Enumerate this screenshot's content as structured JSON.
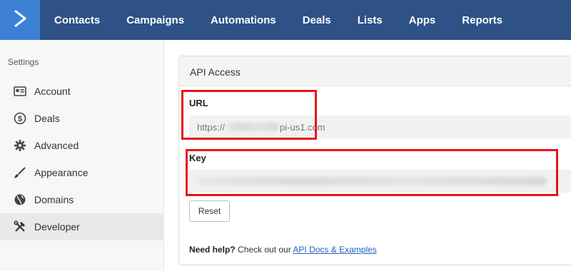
{
  "nav": {
    "logo_icon": "chevron-right-icon",
    "items": [
      "Contacts",
      "Campaigns",
      "Automations",
      "Deals",
      "Lists",
      "Apps",
      "Reports"
    ]
  },
  "sidebar": {
    "heading": "Settings",
    "items": [
      {
        "label": "Account",
        "icon": "id-card-icon"
      },
      {
        "label": "Deals",
        "icon": "dollar-icon"
      },
      {
        "label": "Advanced",
        "icon": "gear-icon"
      },
      {
        "label": "Appearance",
        "icon": "brush-icon"
      },
      {
        "label": "Domains",
        "icon": "globe-icon"
      },
      {
        "label": "Developer",
        "icon": "tools-icon",
        "active": true
      }
    ]
  },
  "panel": {
    "title": "API Access",
    "url_label": "URL",
    "url_prefix": "https://",
    "url_suffix": "pi-us1.com",
    "key_label": "Key",
    "reset_label": "Reset",
    "help_prefix": "Need help?",
    "help_middle": " Check out our ",
    "help_link": "API Docs & Examples"
  },
  "colors": {
    "topbar": "#2f5286",
    "logo_bg": "#3c80d6",
    "highlight": "#e8141a",
    "link": "#1f5fbf"
  }
}
